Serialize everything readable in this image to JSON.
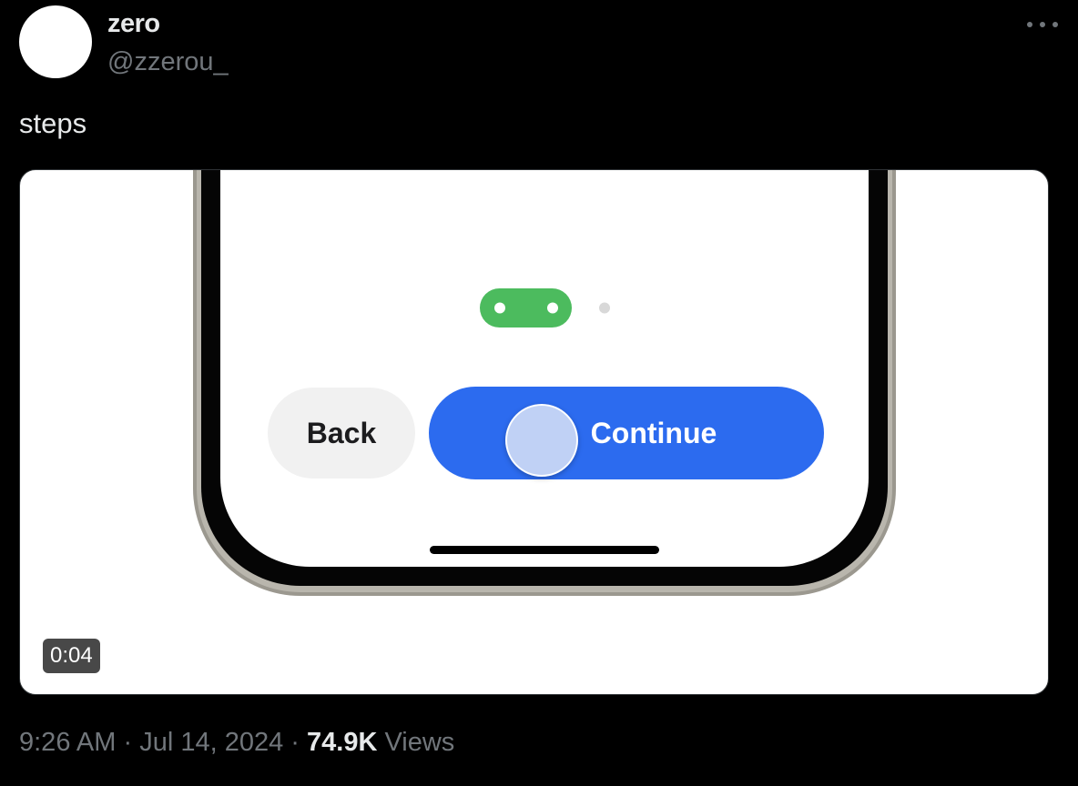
{
  "author": {
    "display_name": "zero",
    "handle": "@zzerou_"
  },
  "tweet": {
    "text": "steps"
  },
  "media": {
    "type": "video",
    "duration": "0:04",
    "content": {
      "back_label": "Back",
      "continue_label": "Continue",
      "page_indicator": {
        "total_steps": 3,
        "completed_steps": 2,
        "active_color": "#4cbb5e",
        "inactive_color": "#d8d8d8"
      },
      "continue_color": "#2c6bef"
    }
  },
  "meta": {
    "time": "9:26 AM",
    "separator": "·",
    "date": "Jul 14, 2024",
    "views_count": "74.9K",
    "views_label": "Views"
  },
  "icons": {
    "more": "more-horizontal-icon"
  }
}
